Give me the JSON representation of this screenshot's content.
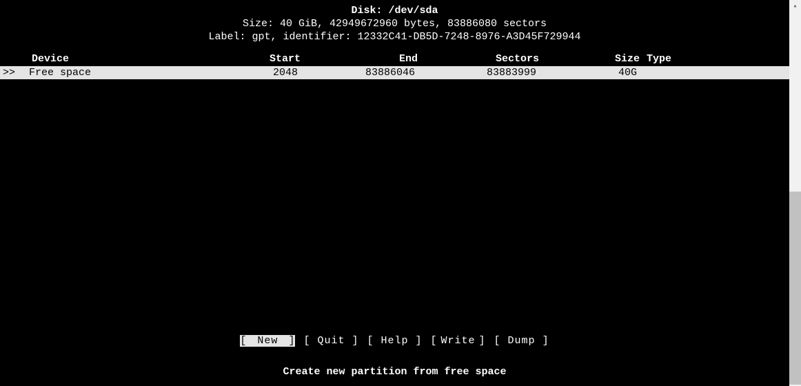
{
  "header": {
    "disk_label": "Disk: /dev/sda",
    "size_line": "Size: 40 GiB, 42949672960 bytes, 83886080 sectors",
    "label_line": "Label: gpt, identifier: 12332C41-DB5D-7248-8976-A3D45F729944"
  },
  "table": {
    "columns": {
      "device": "Device",
      "start": "Start",
      "end": "End",
      "sectors": "Sectors",
      "size": "Size",
      "type": "Type"
    },
    "rows": [
      {
        "marker": ">>",
        "device": "Free space",
        "start": "2048",
        "end": "83886046",
        "sectors": "83883999",
        "size": "40G",
        "type": ""
      }
    ]
  },
  "menu": {
    "items": [
      {
        "label": "New",
        "selected": true
      },
      {
        "label": "Quit",
        "selected": false
      },
      {
        "label": "Help",
        "selected": false
      },
      {
        "label": "Write",
        "selected": false
      },
      {
        "label": "Dump",
        "selected": false
      }
    ]
  },
  "hint": "Create new partition from free space",
  "scrollbar": {
    "arrow_up": "▴"
  }
}
